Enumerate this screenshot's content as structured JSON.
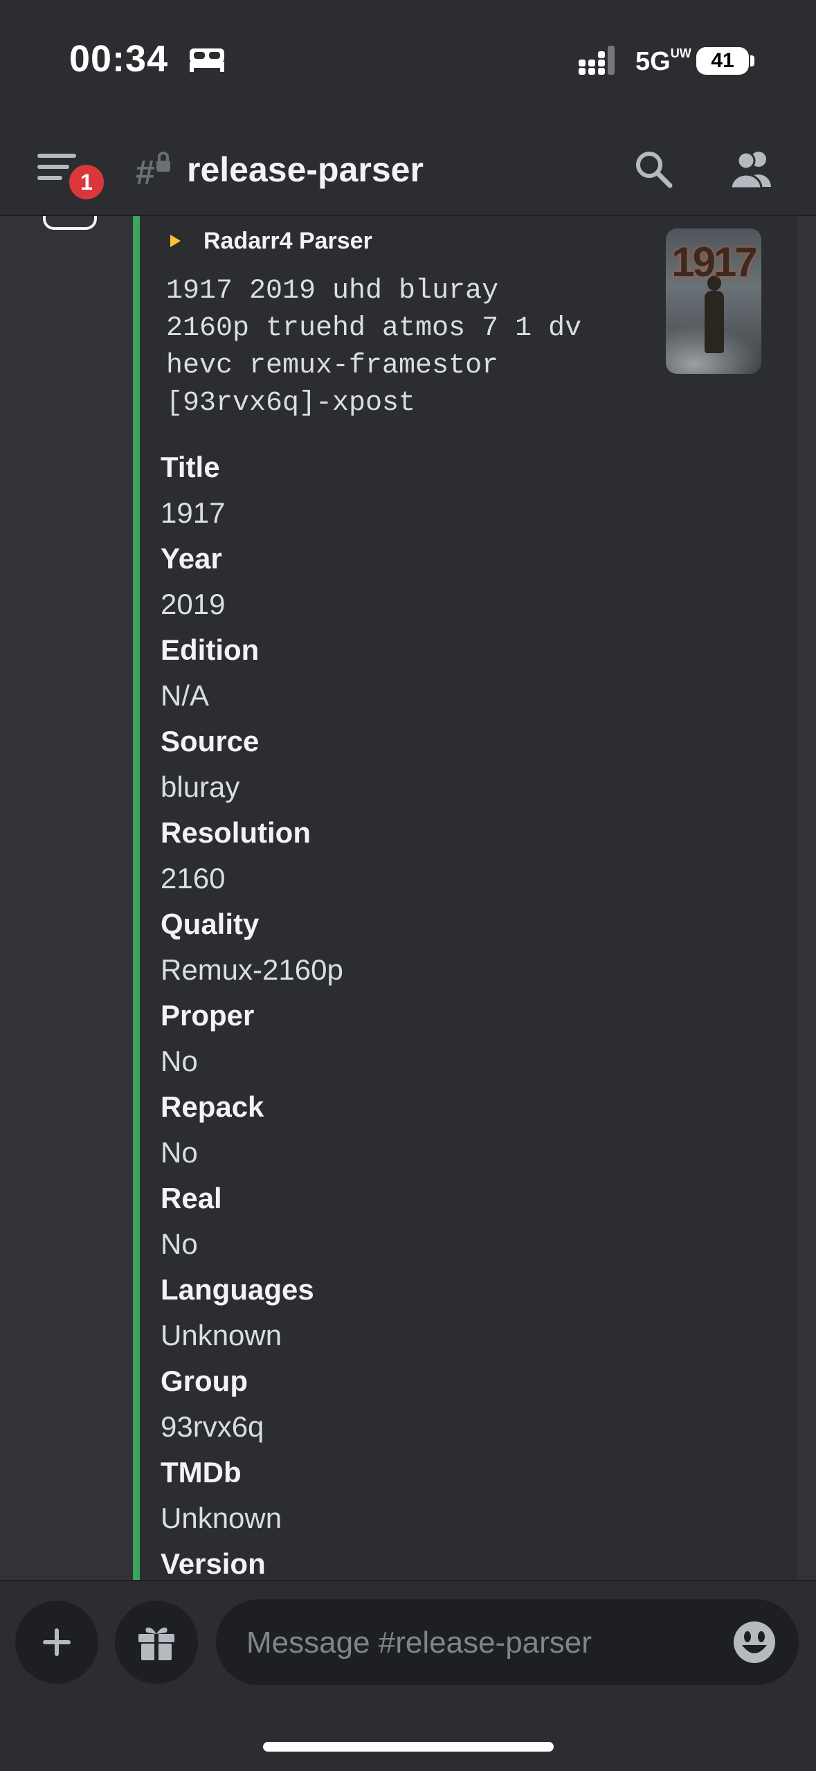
{
  "status_bar": {
    "time": "00:34",
    "network": "5G",
    "network_sup": "UW",
    "battery": "41"
  },
  "header": {
    "channel_name": "release-parser",
    "notification_count": "1"
  },
  "embed": {
    "author": "Radarr4 Parser",
    "description": "1917 2019 uhd bluray\n2160p truehd atmos 7 1 dv\nhevc remux-framestor\n[93rvx6q]-xpost",
    "thumbnail_text": "1917",
    "accent_color": "#3ba55d",
    "fields": [
      {
        "name": "Title",
        "value": "1917"
      },
      {
        "name": "Year",
        "value": "2019"
      },
      {
        "name": "Edition",
        "value": "N/A"
      },
      {
        "name": "Source",
        "value": "bluray"
      },
      {
        "name": "Resolution",
        "value": "2160"
      },
      {
        "name": "Quality",
        "value": "Remux-2160p"
      },
      {
        "name": "Proper",
        "value": "No"
      },
      {
        "name": "Repack",
        "value": "No"
      },
      {
        "name": "Real",
        "value": "No"
      },
      {
        "name": "Languages",
        "value": "Unknown"
      },
      {
        "name": "Group",
        "value": "93rvx6q"
      },
      {
        "name": "TMDb",
        "value": "Unknown"
      },
      {
        "name": "Version",
        "value": ""
      }
    ]
  },
  "composer": {
    "placeholder": "Message #release-parser"
  },
  "icons": [
    "bed-icon",
    "signal-icon",
    "hamburger-icon",
    "channel-lock-icon",
    "search-icon",
    "members-icon",
    "plus-icon",
    "gift-icon",
    "emoji-icon",
    "play-icon"
  ]
}
